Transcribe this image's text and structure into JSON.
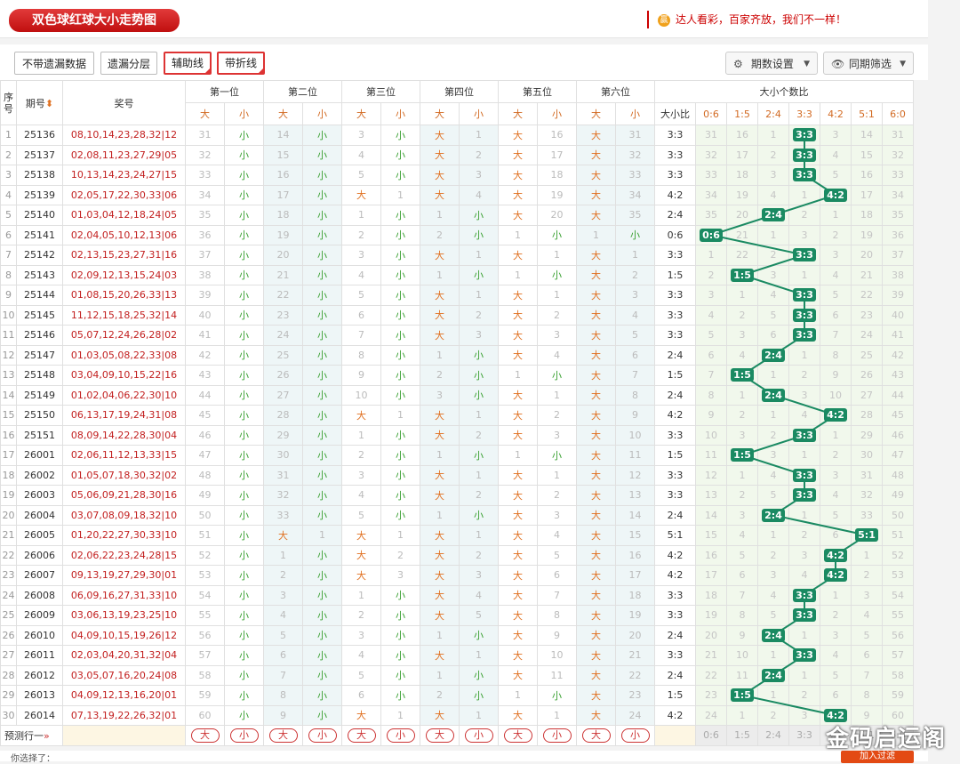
{
  "header": {
    "title": "双色球红球大小走势图",
    "slogan": "达人看彩，百家齐放，我们不一样！",
    "slogan_badge": "赢"
  },
  "toolbar": {
    "buttons": [
      "不带遗漏数据",
      "遗漏分层",
      "辅助线",
      "带折线"
    ],
    "period_setting": "期数设置",
    "same_filter": "同期筛选"
  },
  "table": {
    "col_seq": "序号",
    "col_issue": "期号",
    "col_prize": "奖号",
    "positions": [
      "第一位",
      "第二位",
      "第三位",
      "第四位",
      "第五位",
      "第六位"
    ],
    "big_label": "大",
    "small_label": "小",
    "ratio_group": "大小个数比",
    "ratio_col": "大小比",
    "ratio_keys": [
      "0:6",
      "1:5",
      "2:4",
      "3:3",
      "4:2",
      "5:1",
      "6:0"
    ],
    "rows": [
      {
        "seq": "1",
        "issue": "25136",
        "prize": "08,10,14,23,28,32",
        "blue": "12",
        "pos": [
          "31",
          "小",
          "14",
          "小",
          "3",
          "小",
          "大",
          "1",
          "大",
          "16",
          "大",
          "31"
        ],
        "ratio": "3:3",
        "dist": [
          "31",
          "16",
          "1",
          "3:3",
          "3",
          "14",
          "31"
        ],
        "hit": 3
      },
      {
        "seq": "2",
        "issue": "25137",
        "prize": "02,08,11,23,27,29",
        "blue": "05",
        "pos": [
          "32",
          "小",
          "15",
          "小",
          "4",
          "小",
          "大",
          "2",
          "大",
          "17",
          "大",
          "32"
        ],
        "ratio": "3:3",
        "dist": [
          "32",
          "17",
          "2",
          "3:3",
          "4",
          "15",
          "32"
        ],
        "hit": 3
      },
      {
        "seq": "3",
        "issue": "25138",
        "prize": "10,13,14,23,24,27",
        "blue": "15",
        "pos": [
          "33",
          "小",
          "16",
          "小",
          "5",
          "小",
          "大",
          "3",
          "大",
          "18",
          "大",
          "33"
        ],
        "ratio": "3:3",
        "dist": [
          "33",
          "18",
          "3",
          "3:3",
          "5",
          "16",
          "33"
        ],
        "hit": 3
      },
      {
        "seq": "4",
        "issue": "25139",
        "prize": "02,05,17,22,30,33",
        "blue": "06",
        "pos": [
          "34",
          "小",
          "17",
          "小",
          "大",
          "1",
          "大",
          "4",
          "大",
          "19",
          "大",
          "34"
        ],
        "ratio": "4:2",
        "dist": [
          "34",
          "19",
          "4",
          "1",
          "4:2",
          "17",
          "34"
        ],
        "hit": 4
      },
      {
        "seq": "5",
        "issue": "25140",
        "prize": "01,03,04,12,18,24",
        "blue": "05",
        "pos": [
          "35",
          "小",
          "18",
          "小",
          "1",
          "小",
          "1",
          "小",
          "大",
          "20",
          "大",
          "35"
        ],
        "ratio": "2:4",
        "dist": [
          "35",
          "20",
          "2:4",
          "2",
          "1",
          "18",
          "35"
        ],
        "hit": 2
      },
      {
        "seq": "6",
        "issue": "25141",
        "prize": "02,04,05,10,12,13",
        "blue": "06",
        "pos": [
          "36",
          "小",
          "19",
          "小",
          "2",
          "小",
          "2",
          "小",
          "1",
          "小",
          "1",
          "小"
        ],
        "ratio": "0:6",
        "dist": [
          "0:6",
          "21",
          "1",
          "3",
          "2",
          "19",
          "36"
        ],
        "hit": 0
      },
      {
        "seq": "7",
        "issue": "25142",
        "prize": "02,13,15,23,27,31",
        "blue": "16",
        "pos": [
          "37",
          "小",
          "20",
          "小",
          "3",
          "小",
          "大",
          "1",
          "大",
          "1",
          "大",
          "1"
        ],
        "ratio": "3:3",
        "dist": [
          "1",
          "22",
          "2",
          "3:3",
          "3",
          "20",
          "37"
        ],
        "hit": 3
      },
      {
        "seq": "8",
        "issue": "25143",
        "prize": "02,09,12,13,15,24",
        "blue": "03",
        "pos": [
          "38",
          "小",
          "21",
          "小",
          "4",
          "小",
          "1",
          "小",
          "1",
          "小",
          "大",
          "2"
        ],
        "ratio": "1:5",
        "dist": [
          "2",
          "1:5",
          "3",
          "1",
          "4",
          "21",
          "38"
        ],
        "hit": 1
      },
      {
        "seq": "9",
        "issue": "25144",
        "prize": "01,08,15,20,26,33",
        "blue": "13",
        "pos": [
          "39",
          "小",
          "22",
          "小",
          "5",
          "小",
          "大",
          "1",
          "大",
          "1",
          "大",
          "3"
        ],
        "ratio": "3:3",
        "dist": [
          "3",
          "1",
          "4",
          "3:3",
          "5",
          "22",
          "39"
        ],
        "hit": 3
      },
      {
        "seq": "10",
        "issue": "25145",
        "prize": "11,12,15,18,25,32",
        "blue": "14",
        "pos": [
          "40",
          "小",
          "23",
          "小",
          "6",
          "小",
          "大",
          "2",
          "大",
          "2",
          "大",
          "4"
        ],
        "ratio": "3:3",
        "dist": [
          "4",
          "2",
          "5",
          "3:3",
          "6",
          "23",
          "40"
        ],
        "hit": 3
      },
      {
        "seq": "11",
        "issue": "25146",
        "prize": "05,07,12,24,26,28",
        "blue": "02",
        "pos": [
          "41",
          "小",
          "24",
          "小",
          "7",
          "小",
          "大",
          "3",
          "大",
          "3",
          "大",
          "5"
        ],
        "ratio": "3:3",
        "dist": [
          "5",
          "3",
          "6",
          "3:3",
          "7",
          "24",
          "41"
        ],
        "hit": 3
      },
      {
        "seq": "12",
        "issue": "25147",
        "prize": "01,03,05,08,22,33",
        "blue": "08",
        "pos": [
          "42",
          "小",
          "25",
          "小",
          "8",
          "小",
          "1",
          "小",
          "大",
          "4",
          "大",
          "6"
        ],
        "ratio": "2:4",
        "dist": [
          "6",
          "4",
          "2:4",
          "1",
          "8",
          "25",
          "42"
        ],
        "hit": 2
      },
      {
        "seq": "13",
        "issue": "25148",
        "prize": "03,04,09,10,15,22",
        "blue": "16",
        "pos": [
          "43",
          "小",
          "26",
          "小",
          "9",
          "小",
          "2",
          "小",
          "1",
          "小",
          "大",
          "7"
        ],
        "ratio": "1:5",
        "dist": [
          "7",
          "1:5",
          "1",
          "2",
          "9",
          "26",
          "43"
        ],
        "hit": 1
      },
      {
        "seq": "14",
        "issue": "25149",
        "prize": "01,02,04,06,22,30",
        "blue": "10",
        "pos": [
          "44",
          "小",
          "27",
          "小",
          "10",
          "小",
          "3",
          "小",
          "大",
          "1",
          "大",
          "8"
        ],
        "ratio": "2:4",
        "dist": [
          "8",
          "1",
          "2:4",
          "3",
          "10",
          "27",
          "44"
        ],
        "hit": 2
      },
      {
        "seq": "15",
        "issue": "25150",
        "prize": "06,13,17,19,24,31",
        "blue": "08",
        "pos": [
          "45",
          "小",
          "28",
          "小",
          "大",
          "1",
          "大",
          "1",
          "大",
          "2",
          "大",
          "9"
        ],
        "ratio": "4:2",
        "dist": [
          "9",
          "2",
          "1",
          "4",
          "4:2",
          "28",
          "45"
        ],
        "hit": 4
      },
      {
        "seq": "16",
        "issue": "25151",
        "prize": "08,09,14,22,28,30",
        "blue": "04",
        "pos": [
          "46",
          "小",
          "29",
          "小",
          "1",
          "小",
          "大",
          "2",
          "大",
          "3",
          "大",
          "10"
        ],
        "ratio": "3:3",
        "dist": [
          "10",
          "3",
          "2",
          "3:3",
          "1",
          "29",
          "46"
        ],
        "hit": 3
      },
      {
        "seq": "17",
        "issue": "26001",
        "prize": "02,06,11,12,13,33",
        "blue": "15",
        "pos": [
          "47",
          "小",
          "30",
          "小",
          "2",
          "小",
          "1",
          "小",
          "1",
          "小",
          "大",
          "11"
        ],
        "ratio": "1:5",
        "dist": [
          "11",
          "1:5",
          "3",
          "1",
          "2",
          "30",
          "47"
        ],
        "hit": 1
      },
      {
        "seq": "18",
        "issue": "26002",
        "prize": "01,05,07,18,30,32",
        "blue": "02",
        "pos": [
          "48",
          "小",
          "31",
          "小",
          "3",
          "小",
          "大",
          "1",
          "大",
          "1",
          "大",
          "12"
        ],
        "ratio": "3:3",
        "dist": [
          "12",
          "1",
          "4",
          "3:3",
          "3",
          "31",
          "48"
        ],
        "hit": 3
      },
      {
        "seq": "19",
        "issue": "26003",
        "prize": "05,06,09,21,28,30",
        "blue": "16",
        "pos": [
          "49",
          "小",
          "32",
          "小",
          "4",
          "小",
          "大",
          "2",
          "大",
          "2",
          "大",
          "13"
        ],
        "ratio": "3:3",
        "dist": [
          "13",
          "2",
          "5",
          "3:3",
          "4",
          "32",
          "49"
        ],
        "hit": 3
      },
      {
        "seq": "20",
        "issue": "26004",
        "prize": "03,07,08,09,18,32",
        "blue": "10",
        "pos": [
          "50",
          "小",
          "33",
          "小",
          "5",
          "小",
          "1",
          "小",
          "大",
          "3",
          "大",
          "14"
        ],
        "ratio": "2:4",
        "dist": [
          "14",
          "3",
          "2:4",
          "1",
          "5",
          "33",
          "50"
        ],
        "hit": 2
      },
      {
        "seq": "21",
        "issue": "26005",
        "prize": "01,20,22,27,30,33",
        "blue": "10",
        "pos": [
          "51",
          "小",
          "大",
          "1",
          "大",
          "1",
          "大",
          "1",
          "大",
          "4",
          "大",
          "15"
        ],
        "ratio": "5:1",
        "dist": [
          "15",
          "4",
          "1",
          "2",
          "6",
          "5:1",
          "51"
        ],
        "hit": 5
      },
      {
        "seq": "22",
        "issue": "26006",
        "prize": "02,06,22,23,24,28",
        "blue": "15",
        "pos": [
          "52",
          "小",
          "1",
          "小",
          "大",
          "2",
          "大",
          "2",
          "大",
          "5",
          "大",
          "16"
        ],
        "ratio": "4:2",
        "dist": [
          "16",
          "5",
          "2",
          "3",
          "4:2",
          "1",
          "52"
        ],
        "hit": 4
      },
      {
        "seq": "23",
        "issue": "26007",
        "prize": "09,13,19,27,29,30",
        "blue": "01",
        "pos": [
          "53",
          "小",
          "2",
          "小",
          "大",
          "3",
          "大",
          "3",
          "大",
          "6",
          "大",
          "17"
        ],
        "ratio": "4:2",
        "dist": [
          "17",
          "6",
          "3",
          "4",
          "4:2",
          "2",
          "53"
        ],
        "hit": 4
      },
      {
        "seq": "24",
        "issue": "26008",
        "prize": "06,09,16,27,31,33",
        "blue": "10",
        "pos": [
          "54",
          "小",
          "3",
          "小",
          "1",
          "小",
          "大",
          "4",
          "大",
          "7",
          "大",
          "18"
        ],
        "ratio": "3:3",
        "dist": [
          "18",
          "7",
          "4",
          "3:3",
          "1",
          "3",
          "54"
        ],
        "hit": 3
      },
      {
        "seq": "25",
        "issue": "26009",
        "prize": "03,06,13,19,23,25",
        "blue": "10",
        "pos": [
          "55",
          "小",
          "4",
          "小",
          "2",
          "小",
          "大",
          "5",
          "大",
          "8",
          "大",
          "19"
        ],
        "ratio": "3:3",
        "dist": [
          "19",
          "8",
          "5",
          "3:3",
          "2",
          "4",
          "55"
        ],
        "hit": 3
      },
      {
        "seq": "26",
        "issue": "26010",
        "prize": "04,09,10,15,19,26",
        "blue": "12",
        "pos": [
          "56",
          "小",
          "5",
          "小",
          "3",
          "小",
          "1",
          "小",
          "大",
          "9",
          "大",
          "20"
        ],
        "ratio": "2:4",
        "dist": [
          "20",
          "9",
          "2:4",
          "1",
          "3",
          "5",
          "56"
        ],
        "hit": 2
      },
      {
        "seq": "27",
        "issue": "26011",
        "prize": "02,03,04,20,31,32",
        "blue": "04",
        "pos": [
          "57",
          "小",
          "6",
          "小",
          "4",
          "小",
          "大",
          "1",
          "大",
          "10",
          "大",
          "21"
        ],
        "ratio": "3:3",
        "dist": [
          "21",
          "10",
          "1",
          "3:3",
          "4",
          "6",
          "57"
        ],
        "hit": 3
      },
      {
        "seq": "28",
        "issue": "26012",
        "prize": "03,05,07,16,20,24",
        "blue": "08",
        "pos": [
          "58",
          "小",
          "7",
          "小",
          "5",
          "小",
          "1",
          "小",
          "大",
          "11",
          "大",
          "22"
        ],
        "ratio": "2:4",
        "dist": [
          "22",
          "11",
          "2:4",
          "1",
          "5",
          "7",
          "58"
        ],
        "hit": 2
      },
      {
        "seq": "29",
        "issue": "26013",
        "prize": "04,09,12,13,16,20",
        "blue": "01",
        "pos": [
          "59",
          "小",
          "8",
          "小",
          "6",
          "小",
          "2",
          "小",
          "1",
          "小",
          "大",
          "23"
        ],
        "ratio": "1:5",
        "dist": [
          "23",
          "1:5",
          "1",
          "2",
          "6",
          "8",
          "59"
        ],
        "hit": 1
      },
      {
        "seq": "30",
        "issue": "26014",
        "prize": "07,13,19,22,26,32",
        "blue": "01",
        "pos": [
          "60",
          "小",
          "9",
          "小",
          "大",
          "1",
          "大",
          "1",
          "大",
          "1",
          "大",
          "24"
        ],
        "ratio": "4:2",
        "dist": [
          "24",
          "1",
          "2",
          "3",
          "4:2",
          "9",
          "60"
        ],
        "hit": 4
      }
    ],
    "predict_label": "预测行一"
  },
  "bottom": {
    "choice_label": "你选择了：",
    "add_button": "加入过滤"
  },
  "watermark": "金码启运阁",
  "colors": {
    "accent_red": "#c00f0f",
    "big": "#e07020",
    "small": "#3aa032",
    "hit": "#1a8a62"
  }
}
